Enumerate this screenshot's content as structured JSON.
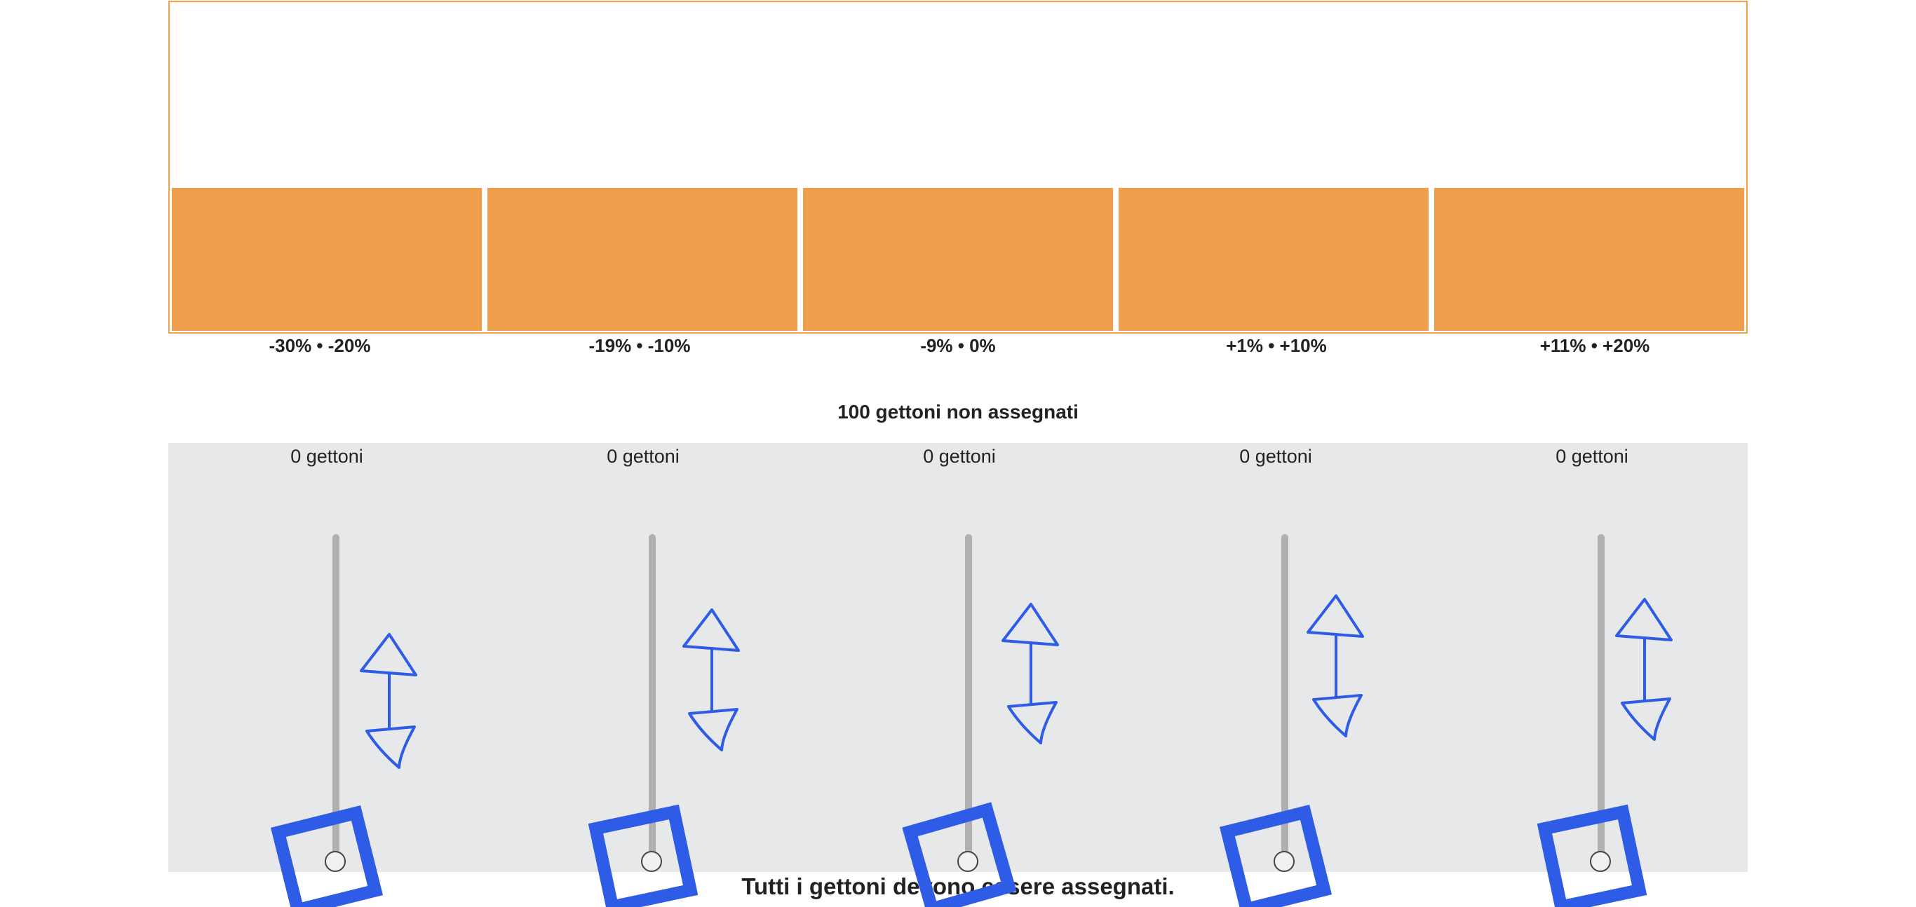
{
  "chart_data": {
    "type": "bar",
    "categories": [
      "-30% • -20%",
      "-19% • -10%",
      "-9% • 0%",
      "+1% • +10%",
      "+11% • +20%"
    ],
    "values": [
      0,
      0,
      0,
      0,
      0
    ]
  },
  "unassigned_label": "100 gettoni non assegnati",
  "sliders": [
    {
      "count_label": "0 gettoni",
      "tokens": 0
    },
    {
      "count_label": "0 gettoni",
      "tokens": 0
    },
    {
      "count_label": "0 gettoni",
      "tokens": 0
    },
    {
      "count_label": "0 gettoni",
      "tokens": 0
    },
    {
      "count_label": "0 gettoni",
      "tokens": 0
    }
  ],
  "footer_message": "Tutti i gettoni devono essere assegnati.",
  "colors": {
    "bar_fill": "#ef9f4b",
    "chart_border": "#f0a24d",
    "annotation": "#2e5ce6",
    "panel_bg": "#e7e8ea"
  }
}
